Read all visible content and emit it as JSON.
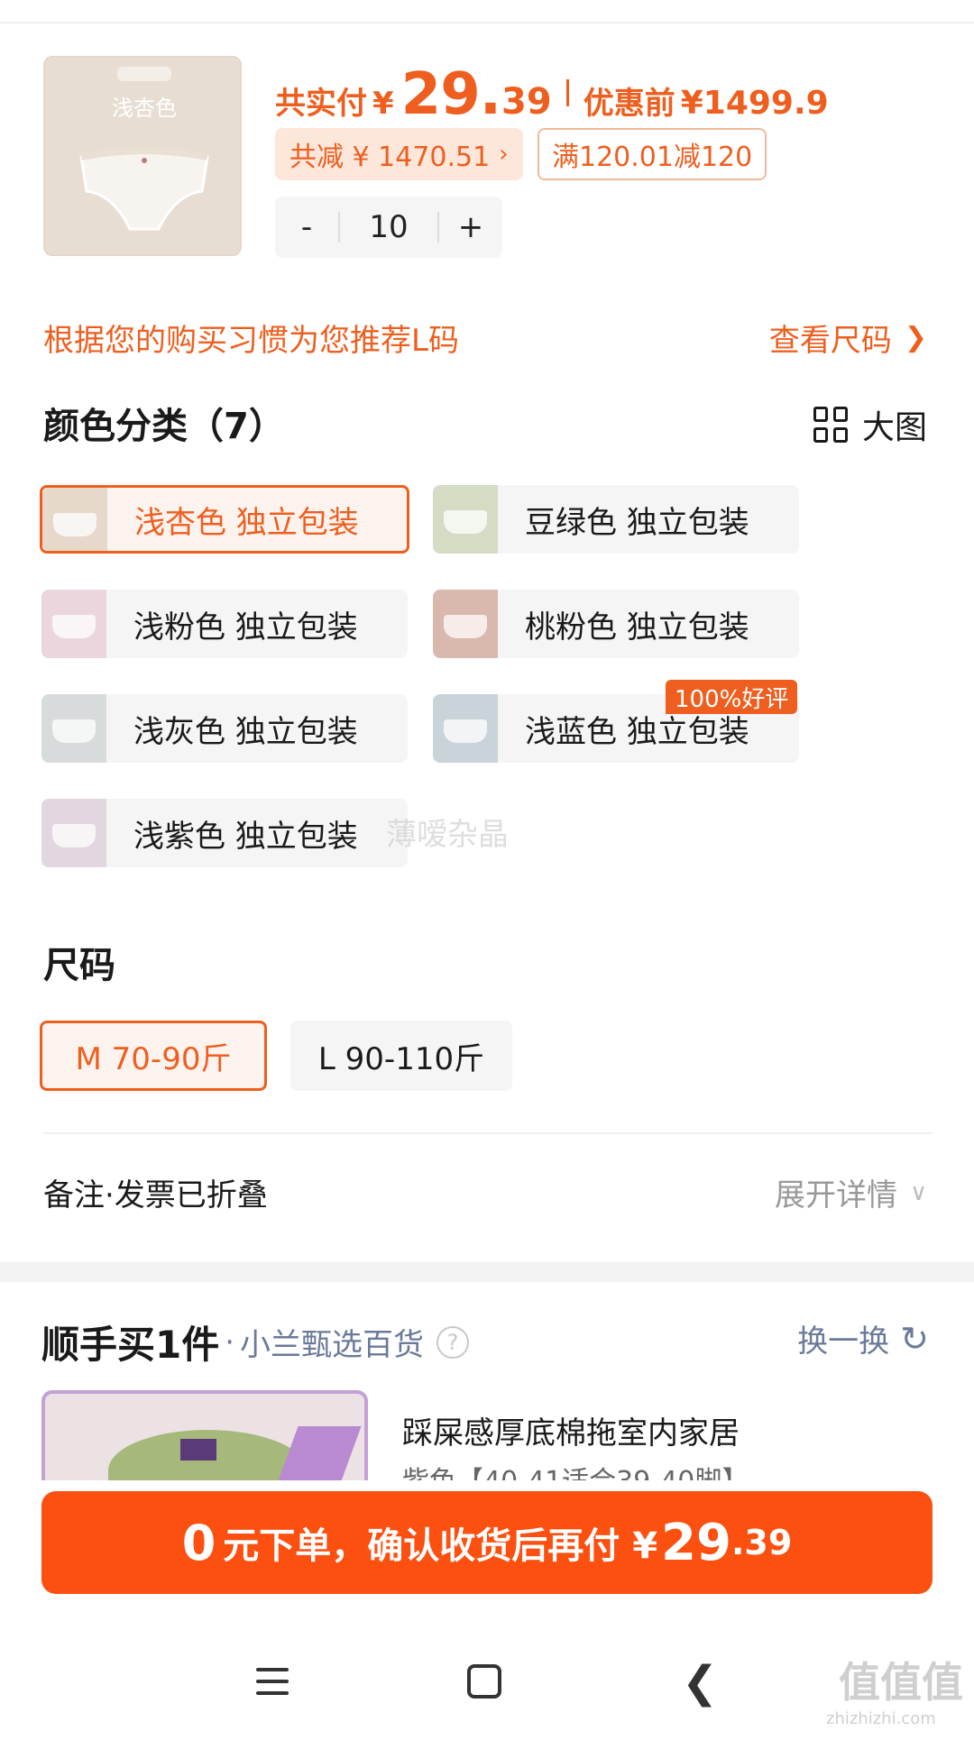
{
  "product": {
    "thumb_label": "浅杏色",
    "pay_label": "共实付",
    "currency": "¥",
    "price_int": "29",
    "price_dot": ".",
    "price_dec": "39",
    "before_label": "优惠前",
    "before_price": "¥1499.9",
    "reduce_label": "共减 ¥ 1470.51",
    "coupon_label": "满120.01减120",
    "quantity": "10",
    "minus": "-",
    "plus": "+"
  },
  "recommend": {
    "text": "根据您的购买习惯为您推荐L码",
    "size_link": "查看尺码"
  },
  "color_section": {
    "title": "颜色分类（7）",
    "big_view": "大图",
    "badge": "100%好评",
    "options": [
      {
        "label": "浅杏色 独立包装",
        "selected": true,
        "swatch": "#e6d8cb"
      },
      {
        "label": "豆绿色 独立包装",
        "selected": false,
        "swatch": "#d4dcc4"
      },
      {
        "label": "浅粉色 独立包装",
        "selected": false,
        "swatch": "#ead6dc"
      },
      {
        "label": "桃粉色 独立包装",
        "selected": false,
        "swatch": "#d9b8ad"
      },
      {
        "label": "浅灰色 独立包装",
        "selected": false,
        "swatch": "#d8dbdc"
      },
      {
        "label": "浅蓝色 独立包装",
        "selected": false,
        "swatch": "#c9d3da"
      },
      {
        "label": "浅紫色 独立包装",
        "selected": false,
        "swatch": "#e2d6e0"
      }
    ]
  },
  "watermark": "薄嗳杂晶",
  "size_section": {
    "title": "尺码",
    "options": [
      {
        "label": "M 70-90斤",
        "selected": true
      },
      {
        "label": "L 90-110斤",
        "selected": false
      }
    ]
  },
  "notes": {
    "label": "备注·发票已折叠",
    "expand": "展开详情"
  },
  "addon": {
    "brand": "顺手买1件",
    "dot": "·",
    "store": "小兰甄选百货",
    "help": "?",
    "swap": "换一换",
    "item_name": "踩屎感厚底棉拖室内家居",
    "item_sub": "紫色【40-41适合39-40脚】"
  },
  "cta": {
    "zero": "0",
    "text": "元下单，确认收货后再付 ¥",
    "price_int": "29",
    "price_dec": ".39"
  },
  "footer": {
    "logo": "值值值",
    "url": "zhizhizhi.com"
  },
  "colors": {
    "accent": "#ee5f1f",
    "cta": "#fb5010"
  }
}
